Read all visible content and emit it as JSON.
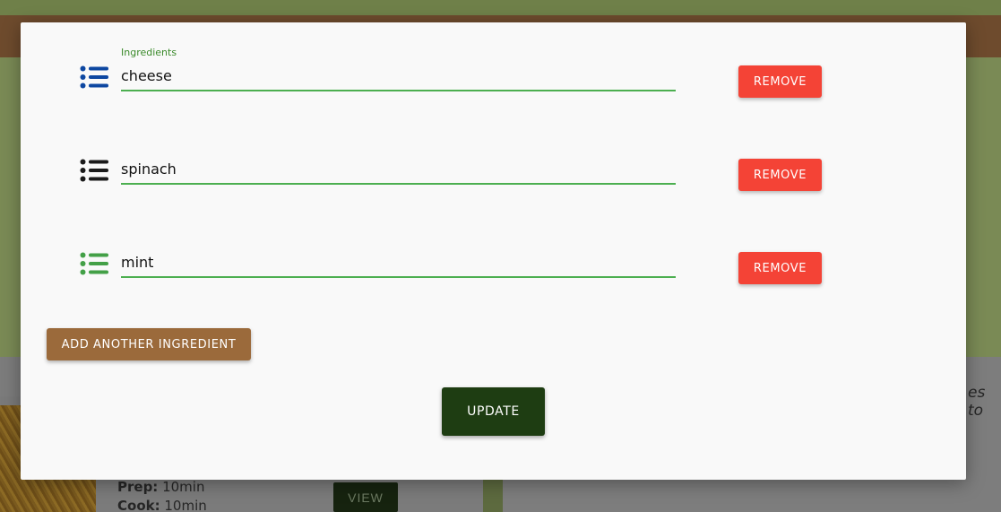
{
  "background": {
    "prep_label": "Prep:",
    "prep_value": "10min",
    "cook_label": "Cook:",
    "cook_value": "10min",
    "view_button": "VIEW",
    "partial_text": "es to"
  },
  "modal": {
    "field_label": "Ingredients",
    "ingredients": [
      {
        "value": "cheese",
        "icon": "list-icon",
        "icon_color": "#0d47a1"
      },
      {
        "value": "spinach",
        "icon": "list-icon",
        "icon_color": "#1a1a1a"
      },
      {
        "value": "mint",
        "icon": "list-icon",
        "icon_color": "#43a047"
      }
    ],
    "remove_label": "REMOVE",
    "add_label": "ADD ANOTHER INGREDIENT",
    "update_label": "UPDATE"
  },
  "colors": {
    "remove": "#f44336",
    "add": "#9b6a3b",
    "update": "#1e3d12",
    "input_underline": "#4caf50"
  }
}
